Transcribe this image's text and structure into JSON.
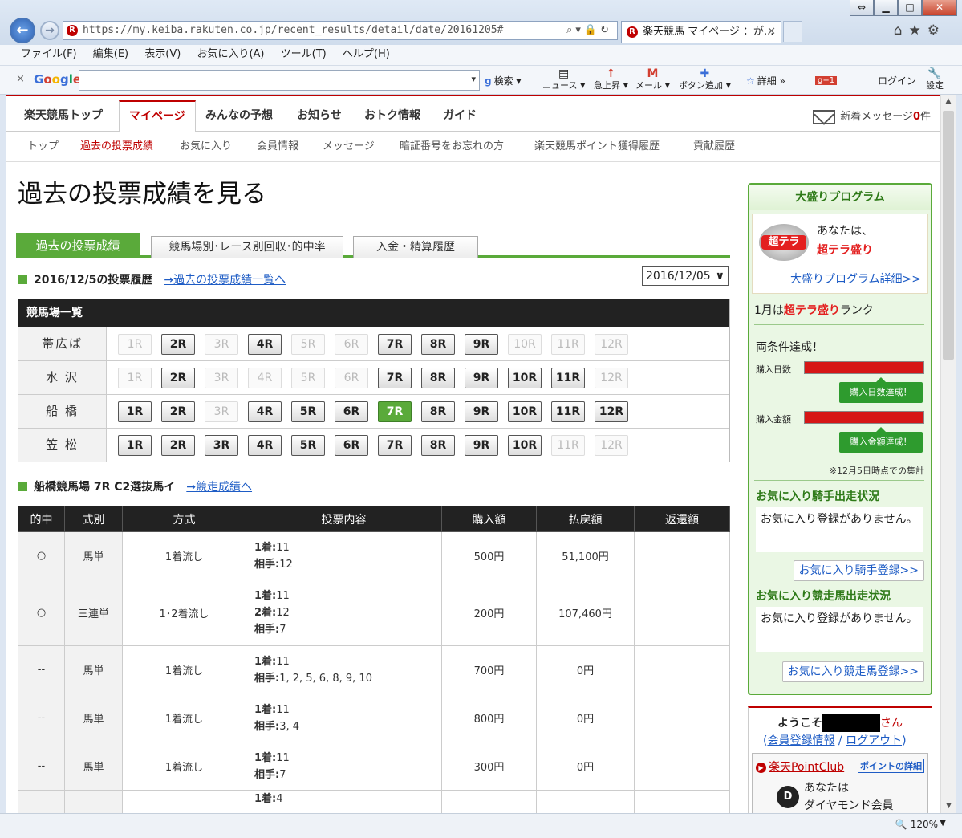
{
  "browser": {
    "url": "https://my.keiba.rakuten.co.jp/recent_results/detail/date/20161205#",
    "tab_title": "楽天競馬 マイページ ：が...",
    "menu": [
      "ファイル(F)",
      "編集(E)",
      "表示(V)",
      "お気に入り(A)",
      "ツール(T)",
      "ヘルプ(H)"
    ],
    "google": {
      "logo": "Google",
      "search_label": "検索",
      "news": "ニュース",
      "trending": "急上昇",
      "mail": "メール",
      "add_button": "ボタン追加",
      "details": "詳細",
      "login": "ログイン",
      "settings": "設定"
    },
    "zoom": "120%"
  },
  "gnav": {
    "items": [
      "楽天競馬トップ",
      "マイページ",
      "みんなの予想",
      "お知らせ",
      "おトク情報",
      "ガイド"
    ],
    "active": "マイページ",
    "message_label": "新着メッセージ",
    "message_count": "0",
    "message_unit": "件"
  },
  "subnav": [
    "トップ",
    "過去の投票成績",
    "お気に入り",
    "会員情報",
    "メッセージ",
    "暗証番号をお忘れの方",
    "楽天競馬ポイント獲得履歴",
    "貢献履歴"
  ],
  "page_title": "過去の投票成績を見る",
  "tabs": [
    "過去の投票成績",
    "競馬場別･レース別回収･的中率",
    "入金・精算履歴"
  ],
  "history": {
    "heading": "2016/12/5の投票履歴",
    "link": "→過去の投票成績一覧へ",
    "date_select": "2016/12/05"
  },
  "tracks": {
    "header": "競馬場一覧",
    "rows": [
      {
        "name": "帯広ば",
        "races": [
          {
            "label": "1R",
            "state": "dis"
          },
          {
            "label": "2R",
            "state": "on"
          },
          {
            "label": "3R",
            "state": "dis"
          },
          {
            "label": "4R",
            "state": "on"
          },
          {
            "label": "5R",
            "state": "dis"
          },
          {
            "label": "6R",
            "state": "dis"
          },
          {
            "label": "7R",
            "state": "on"
          },
          {
            "label": "8R",
            "state": "on"
          },
          {
            "label": "9R",
            "state": "on"
          },
          {
            "label": "10R",
            "state": "dis"
          },
          {
            "label": "11R",
            "state": "dis"
          },
          {
            "label": "12R",
            "state": "dis"
          }
        ]
      },
      {
        "name": "水 沢",
        "races": [
          {
            "label": "1R",
            "state": "dis"
          },
          {
            "label": "2R",
            "state": "on"
          },
          {
            "label": "3R",
            "state": "dis"
          },
          {
            "label": "4R",
            "state": "dis"
          },
          {
            "label": "5R",
            "state": "dis"
          },
          {
            "label": "6R",
            "state": "dis"
          },
          {
            "label": "7R",
            "state": "on"
          },
          {
            "label": "8R",
            "state": "on"
          },
          {
            "label": "9R",
            "state": "on"
          },
          {
            "label": "10R",
            "state": "on"
          },
          {
            "label": "11R",
            "state": "on"
          },
          {
            "label": "12R",
            "state": "dis"
          }
        ]
      },
      {
        "name": "船 橋",
        "races": [
          {
            "label": "1R",
            "state": "on"
          },
          {
            "label": "2R",
            "state": "on"
          },
          {
            "label": "3R",
            "state": "dis"
          },
          {
            "label": "4R",
            "state": "on"
          },
          {
            "label": "5R",
            "state": "on"
          },
          {
            "label": "6R",
            "state": "on"
          },
          {
            "label": "7R",
            "state": "sel"
          },
          {
            "label": "8R",
            "state": "on"
          },
          {
            "label": "9R",
            "state": "on"
          },
          {
            "label": "10R",
            "state": "on"
          },
          {
            "label": "11R",
            "state": "on"
          },
          {
            "label": "12R",
            "state": "on"
          }
        ]
      },
      {
        "name": "笠 松",
        "races": [
          {
            "label": "1R",
            "state": "on"
          },
          {
            "label": "2R",
            "state": "on"
          },
          {
            "label": "3R",
            "state": "on"
          },
          {
            "label": "4R",
            "state": "on"
          },
          {
            "label": "5R",
            "state": "on"
          },
          {
            "label": "6R",
            "state": "on"
          },
          {
            "label": "7R",
            "state": "on"
          },
          {
            "label": "8R",
            "state": "on"
          },
          {
            "label": "9R",
            "state": "on"
          },
          {
            "label": "10R",
            "state": "on"
          },
          {
            "label": "11R",
            "state": "dis"
          },
          {
            "label": "12R",
            "state": "dis"
          }
        ]
      }
    ]
  },
  "race": {
    "heading": "船橋競馬場 7R C2選抜馬イ",
    "link": "→競走成績へ"
  },
  "bets": {
    "columns": [
      "的中",
      "式別",
      "方式",
      "投票内容",
      "購入額",
      "払戻額",
      "返還額"
    ],
    "rows": [
      {
        "hit": "○",
        "type": "馬単",
        "method": "1着流し",
        "lines": [
          {
            "k": "1着:",
            "v": "11"
          },
          {
            "k": "相手:",
            "v": "12"
          }
        ],
        "amount": "500円",
        "payout": "51,100円",
        "refund": ""
      },
      {
        "hit": "○",
        "type": "三連単",
        "method": "1･2着流し",
        "lines": [
          {
            "k": "1着:",
            "v": "11"
          },
          {
            "k": "2着:",
            "v": "12"
          },
          {
            "k": "相手:",
            "v": "7"
          }
        ],
        "amount": "200円",
        "payout": "107,460円",
        "refund": ""
      },
      {
        "hit": "--",
        "type": "馬単",
        "method": "1着流し",
        "lines": [
          {
            "k": "1着:",
            "v": "11"
          },
          {
            "k": "相手:",
            "v": "1, 2, 5, 6, 8, 9, 10"
          }
        ],
        "amount": "700円",
        "payout": "0円",
        "refund": ""
      },
      {
        "hit": "--",
        "type": "馬単",
        "method": "1着流し",
        "lines": [
          {
            "k": "1着:",
            "v": "11"
          },
          {
            "k": "相手:",
            "v": "3, 4"
          }
        ],
        "amount": "800円",
        "payout": "0円",
        "refund": ""
      },
      {
        "hit": "--",
        "type": "馬単",
        "method": "1着流し",
        "lines": [
          {
            "k": "1着:",
            "v": "11"
          },
          {
            "k": "相手:",
            "v": "7"
          }
        ],
        "amount": "300円",
        "payout": "0円",
        "refund": ""
      },
      {
        "hit": "",
        "type": "",
        "method": "",
        "lines": [
          {
            "k": "1着:",
            "v": "4"
          }
        ],
        "amount": "",
        "payout": "",
        "refund": ""
      }
    ]
  },
  "sidebar": {
    "title": "大盛りプログラム",
    "badge": "超テラ",
    "you": "あなたは、",
    "level": "超テラ盛り",
    "detail_link": "大盛りプログラム詳細>>",
    "month_prefix": "1月は",
    "month_level": "超テラ盛り",
    "month_suffix": "ランク",
    "condition": "両条件達成！",
    "days_label": "購入日数",
    "days_ok": "購入日数達成！",
    "amount_label": "購入金額",
    "amount_ok": "購入金額達成！",
    "note": "※12月5日時点での集計",
    "fav_jockey_h": "お気に入り騎手出走状況",
    "fav_jockey_text": "お気に入り登録がありません。",
    "fav_jockey_btn": "お気に入り騎手登録>>",
    "fav_horse_h": "お気に入り競走馬出走状況",
    "fav_horse_text": "お気に入り登録がありません。",
    "fav_horse_btn": "お気に入り競走馬登録>>"
  },
  "welcome": {
    "prefix": "ようこそ",
    "suffix": "さん",
    "member_info": "会員登録情報",
    "logout": "ログアウト",
    "point_club": "楽天PointClub",
    "point_detail": "ポイントの詳細",
    "you": "あなたは",
    "rank": "ダイヤモンド会員"
  }
}
